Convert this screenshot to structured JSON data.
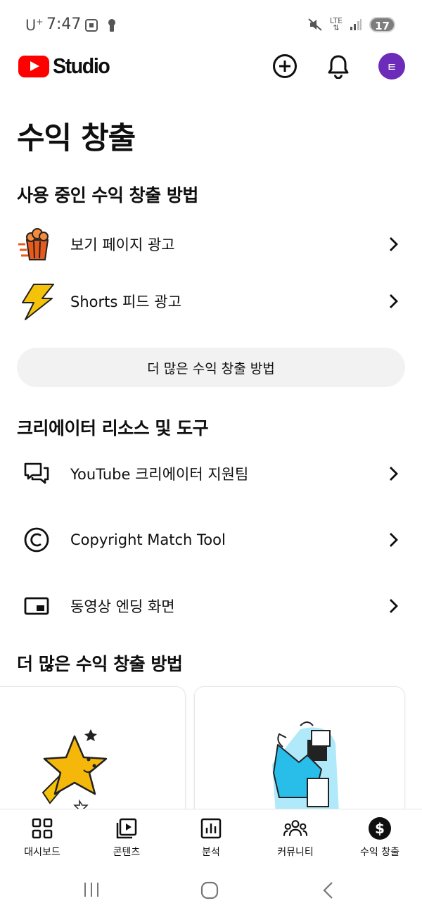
{
  "status_bar": {
    "carrier": "U",
    "carrier_sup": "+",
    "time": "7:47",
    "network": "LTE",
    "battery": "17"
  },
  "header": {
    "logo_text": "Studio",
    "avatar_initial": "ㅌ"
  },
  "page": {
    "title": "수익 창출"
  },
  "active_methods": {
    "title": "사용 중인 수익 창출 방법",
    "items": [
      {
        "label": "보기 페이지 광고",
        "icon": "popcorn-icon"
      },
      {
        "label": "Shorts 피드 광고",
        "icon": "lightning-icon"
      }
    ],
    "more_button": "더 많은 수익 창출 방법"
  },
  "resources": {
    "title": "크리에이터 리소스 및 도구",
    "items": [
      {
        "label": "YouTube 크리에이터 지원팀",
        "icon": "chat-bubbles-icon"
      },
      {
        "label": "Copyright Match Tool",
        "icon": "copyright-icon"
      },
      {
        "label": "동영상 엔딩 화면",
        "icon": "end-screen-icon"
      }
    ]
  },
  "more_methods": {
    "title": "더 많은 수익 창출 방법",
    "cards": [
      {
        "illustration": "shooting-star-illustration"
      },
      {
        "illustration": "shopping-bag-illustration"
      }
    ]
  },
  "bottom_nav": {
    "items": [
      {
        "label": "대시보드",
        "icon": "dashboard-icon"
      },
      {
        "label": "콘텐츠",
        "icon": "content-icon"
      },
      {
        "label": "분석",
        "icon": "analytics-icon"
      },
      {
        "label": "커뮤니티",
        "icon": "community-icon"
      },
      {
        "label": "수익 창출",
        "icon": "monetization-icon",
        "active": true
      }
    ]
  },
  "colors": {
    "brand_red": "#ff0000",
    "avatar_purple": "#6c2bb8",
    "button_grey": "#f2f2f2"
  }
}
